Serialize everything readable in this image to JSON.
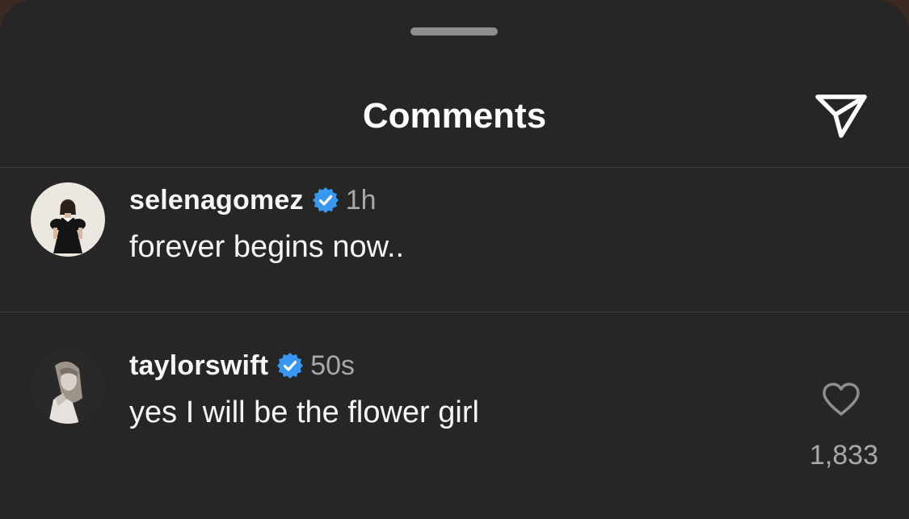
{
  "header": {
    "title": "Comments"
  },
  "comments": [
    {
      "username": "selenagomez",
      "verified": true,
      "time": "1h",
      "text": "forever begins now.."
    },
    {
      "username": "taylorswift",
      "verified": true,
      "time": "50s",
      "text": "yes I will be the flower girl",
      "likes": "1,833"
    }
  ],
  "colors": {
    "background": "#262626",
    "verified_badge": "#3897f0",
    "secondary_text": "#a8a8a8"
  },
  "icons": {
    "share": "paper-plane-icon",
    "verified": "verified-badge-icon",
    "like": "heart-outline-icon"
  }
}
